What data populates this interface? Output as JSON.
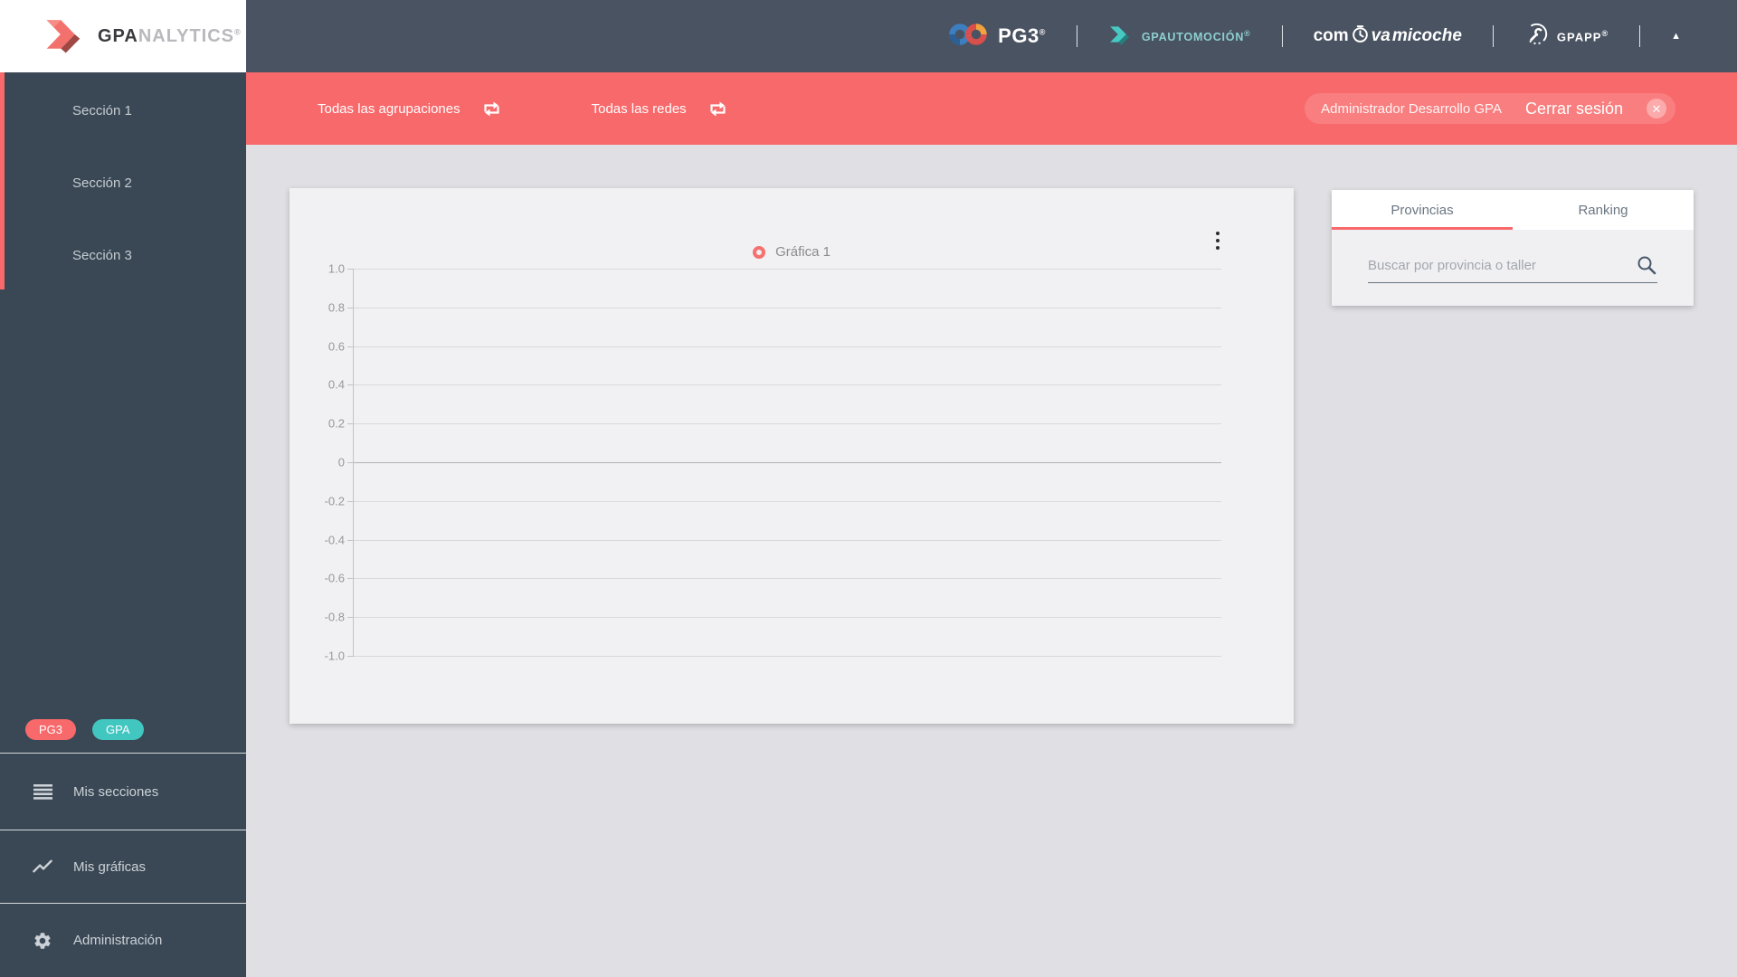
{
  "app_logo": {
    "gpa": "GPA",
    "nalytics": "NALYTICS",
    "reg": "®"
  },
  "header": {
    "pg3_label": "PG3",
    "gpautomocion_label": "GPAUTOMOCIÓN",
    "comprova": {
      "com": "com",
      "va": "va",
      "micoche": "micoche"
    },
    "gpapp_label": "GPAPP",
    "reg": "®"
  },
  "icons": {
    "caret_up": "▲",
    "close_x": "✕"
  },
  "sidebar": {
    "sections": [
      {
        "label": "Sección 1"
      },
      {
        "label": "Sección 2"
      },
      {
        "label": "Sección 3"
      }
    ],
    "badges": [
      {
        "label": "PG3"
      },
      {
        "label": "GPA"
      }
    ],
    "menu": [
      {
        "label": "Mis secciones"
      },
      {
        "label": "Mis gráficas"
      },
      {
        "label": "Administración"
      }
    ]
  },
  "filterbar": {
    "group_filter": "Todas las agrupaciones",
    "network_filter": "Todas las redes",
    "user_name": "Administrador Desarrollo GPA",
    "logout_label": "Cerrar sesión"
  },
  "panel": {
    "tabs": [
      {
        "label": "Provincias",
        "active": true
      },
      {
        "label": "Ranking",
        "active": false
      }
    ],
    "search_placeholder": "Buscar por provincia o taller"
  },
  "chart_data": {
    "type": "line",
    "title": "Gráfica 1",
    "legend": [
      {
        "label": "Gráfica 1",
        "color": "#f5706e",
        "marker": "circle-outline"
      }
    ],
    "legend_position": "top-center",
    "series": [
      {
        "name": "Gráfica 1",
        "x": [],
        "values": []
      }
    ],
    "x": [],
    "xlabel": "",
    "ylabel": "",
    "ylim": [
      -1.0,
      1.0
    ],
    "y_tick_step": 0.2,
    "y_ticks": [
      "1.0",
      "0.8",
      "0.6",
      "0.4",
      "0.2",
      "0",
      "-0.2",
      "-0.4",
      "-0.6",
      "-0.8",
      "-1.0"
    ],
    "grid": true
  },
  "colors": {
    "accent_red": "#f8696b",
    "teal": "#41c6c0",
    "header_bg": "#4a5362",
    "sidebar_bg": "#3a4855",
    "page_bg": "#e0e0e4",
    "card_bg": "#f1f1f3"
  }
}
